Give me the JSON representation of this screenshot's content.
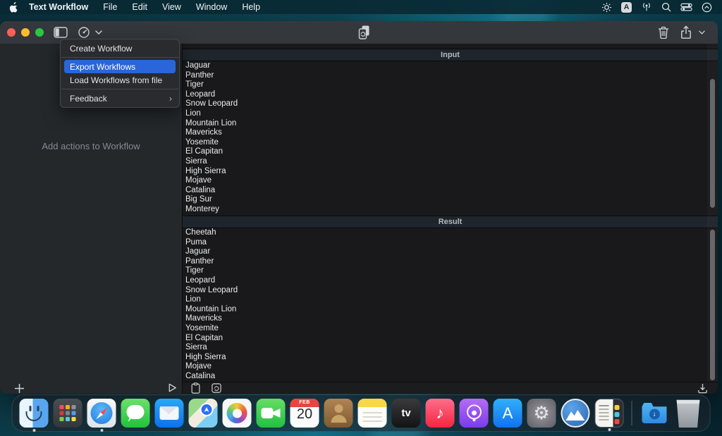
{
  "menu_bar": {
    "app_name": "Text Workflow",
    "menus": [
      "File",
      "Edit",
      "View",
      "Window",
      "Help"
    ],
    "input_source_label": "A",
    "status_icons": [
      "display-brightness-icon",
      "input-source-icon",
      "dictation-icon",
      "spotlight-search-icon",
      "control-center-icon",
      "session-chevron-icon"
    ]
  },
  "toolbar": {
    "icons": [
      "sidebar-toggle-icon",
      "workflow-gauge-icon",
      "chevron-down-icon",
      "duplicate-run-icon",
      "trash-icon",
      "share-icon",
      "share-chevron-icon"
    ]
  },
  "workflow_menu": {
    "items": [
      {
        "label": "Create Workflow",
        "highlighted": false,
        "has_submenu": false
      },
      {
        "label": "Export Workflows",
        "highlighted": true,
        "has_submenu": false
      },
      {
        "label": "Load Workflows from file",
        "highlighted": false,
        "has_submenu": false
      },
      {
        "label": "Feedback",
        "highlighted": false,
        "has_submenu": true
      }
    ],
    "submenu_arrow": "›",
    "highlight_color": "#2a65d9"
  },
  "sidebar": {
    "placeholder": "Add actions to Workflow"
  },
  "input_panel": {
    "title": "Input",
    "items": [
      "Jaguar",
      "Panther",
      "Tiger",
      "Leopard",
      "Snow Leopard",
      "Lion",
      "Mountain Lion",
      "Mavericks",
      "Yosemite",
      "El Capitan",
      "Sierra",
      "High Sierra",
      "Mojave",
      "Catalina",
      "Big Sur",
      "Monterey"
    ]
  },
  "result_panel": {
    "title": "Result",
    "items": [
      "Cheetah",
      "Puma",
      "Jaguar",
      "Panther",
      "Tiger",
      "Leopard",
      "Snow Leopard",
      "Lion",
      "Mountain Lion",
      "Mavericks",
      "Yosemite",
      "El Capitan",
      "Sierra",
      "High Sierra",
      "Mojave",
      "Catalina"
    ]
  },
  "bottom_bar": {
    "icons": [
      "add-action-icon",
      "run-play-icon",
      "clipboard-icon",
      "loop-box-icon",
      "save-to-file-icon"
    ]
  },
  "dock": {
    "apps": [
      {
        "id": "finder",
        "label": "Finder",
        "running": true
      },
      {
        "id": "launchpad",
        "label": "Launchpad",
        "running": false
      },
      {
        "id": "safari",
        "label": "Safari",
        "running": true
      },
      {
        "id": "messages",
        "label": "Messages",
        "running": false
      },
      {
        "id": "mail",
        "label": "Mail",
        "running": false
      },
      {
        "id": "maps",
        "label": "Maps",
        "running": false
      },
      {
        "id": "photos",
        "label": "Photos",
        "running": false
      },
      {
        "id": "facetime",
        "label": "FaceTime",
        "running": false
      },
      {
        "id": "calendar",
        "label": "Calendar",
        "running": false,
        "badge_month": "FEB",
        "badge_day": "20"
      },
      {
        "id": "contacts",
        "label": "Contacts",
        "running": false
      },
      {
        "id": "notes",
        "label": "Notes",
        "running": false
      },
      {
        "id": "appletv",
        "label": "Apple TV",
        "running": false,
        "glyph": "tv"
      },
      {
        "id": "music",
        "label": "Music",
        "running": false,
        "glyph": "♪"
      },
      {
        "id": "podcasts",
        "label": "Podcasts",
        "running": false
      },
      {
        "id": "appstore",
        "label": "App Store",
        "running": false,
        "glyph": "A"
      },
      {
        "id": "settings",
        "label": "System Settings",
        "running": false,
        "glyph": "⚙"
      },
      {
        "id": "mountain",
        "label": "Mountain App",
        "running": false
      },
      {
        "id": "textworkflow",
        "label": "Text Workflow",
        "running": true
      },
      {
        "id": "separator"
      },
      {
        "id": "downloads",
        "label": "Downloads",
        "running": false
      },
      {
        "id": "trash",
        "label": "Trash",
        "running": false
      }
    ]
  },
  "colors": {
    "menu_highlight": "#2a65d9",
    "traffic_red": "#ff5f57",
    "traffic_yellow": "#febc2e",
    "traffic_green": "#28c840",
    "desktop_teal": "#0e4756"
  }
}
